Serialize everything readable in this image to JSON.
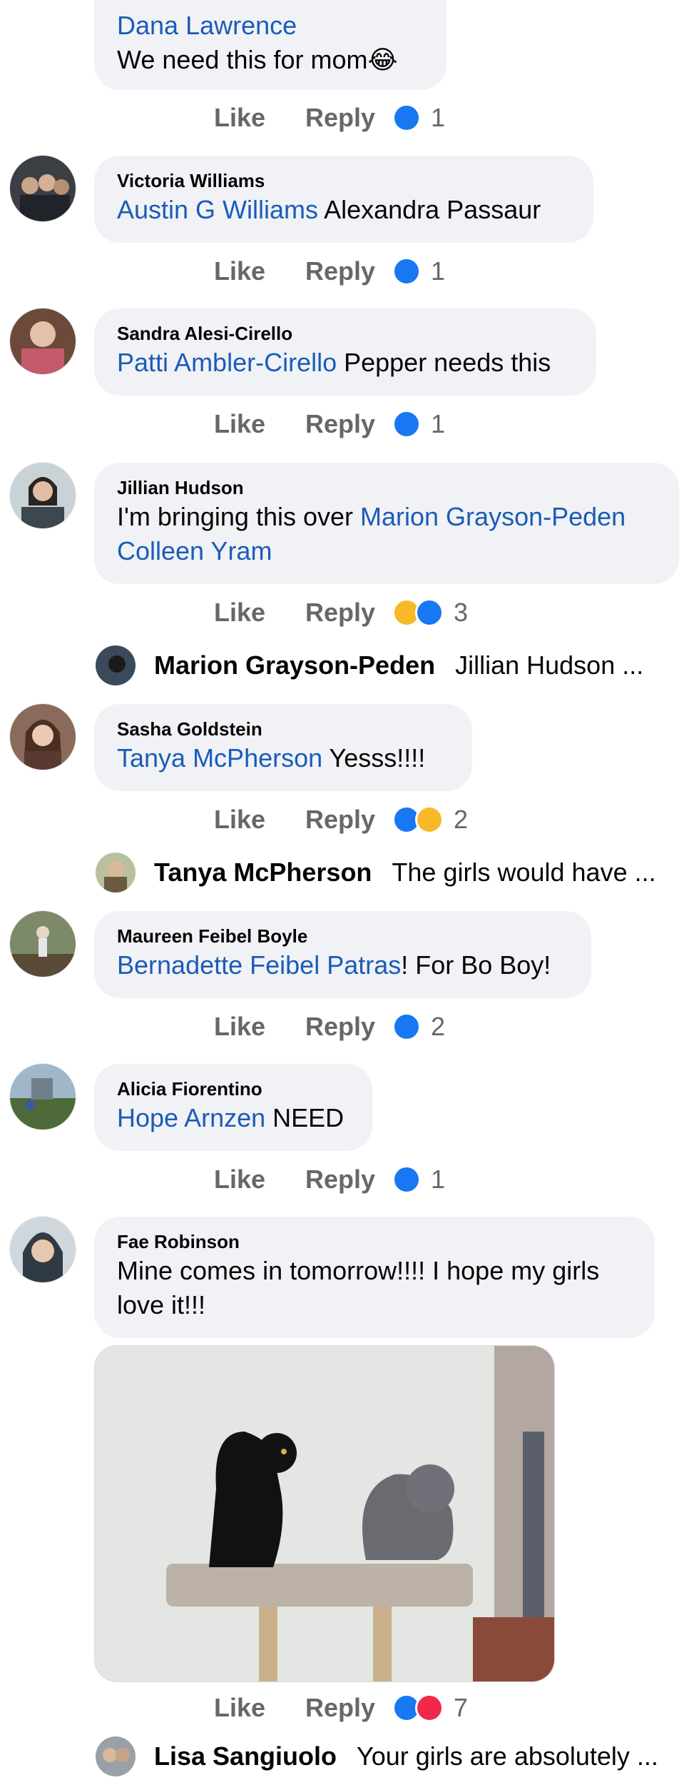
{
  "actions": {
    "like": "Like",
    "reply": "Reply"
  },
  "colors": {
    "mention": "#1c5bb8",
    "like_blue": "#1877f2",
    "haha_yellow": "#f7b928",
    "love_red": "#f02849"
  },
  "comments": [
    {
      "author": "",
      "mention": "Dana Lawrence",
      "text": "We need this for mom😂",
      "reactions": [
        "like"
      ],
      "count": "1"
    },
    {
      "author": "Victoria Williams",
      "mention": "Austin G Williams",
      "text": " Alexandra Passaur",
      "reactions": [
        "like"
      ],
      "count": "1"
    },
    {
      "author": "Sandra Alesi-Cirello",
      "mention": "Patti Ambler-Cirello",
      "text": " Pepper needs this",
      "reactions": [
        "like"
      ],
      "count": "1"
    },
    {
      "author": "Jillian Hudson",
      "text": "I'm bringing this over ",
      "mention": "Marion Grayson-Peden",
      "mention2": "Colleen Yram",
      "reactions": [
        "haha",
        "like"
      ],
      "count": "3",
      "reply": {
        "name": "Marion Grayson-Peden",
        "text": "Jillian Hudson ..."
      }
    },
    {
      "author": "Sasha Goldstein",
      "mention": "Tanya McPherson",
      "text": " Yesss!!!!",
      "reactions": [
        "like",
        "haha"
      ],
      "count": "2",
      "reply": {
        "name": "Tanya McPherson",
        "text": "The girls would have ..."
      }
    },
    {
      "author": "Maureen Feibel Boyle",
      "mention": "Bernadette Feibel Patras",
      "text": "! For Bo Boy!",
      "reactions": [
        "like"
      ],
      "count": "2"
    },
    {
      "author": "Alicia Fiorentino",
      "mention": "Hope Arnzen",
      "text": " NEED",
      "reactions": [
        "like"
      ],
      "count": "1"
    },
    {
      "author": "Fae Robinson",
      "text": "Mine comes in tomorrow!!!! I hope my girls love it!!!",
      "reactions": [
        "like",
        "love"
      ],
      "count": "7",
      "reply": {
        "name": "Lisa Sangiuolo",
        "text": "Your girls are absolutely ..."
      }
    }
  ]
}
